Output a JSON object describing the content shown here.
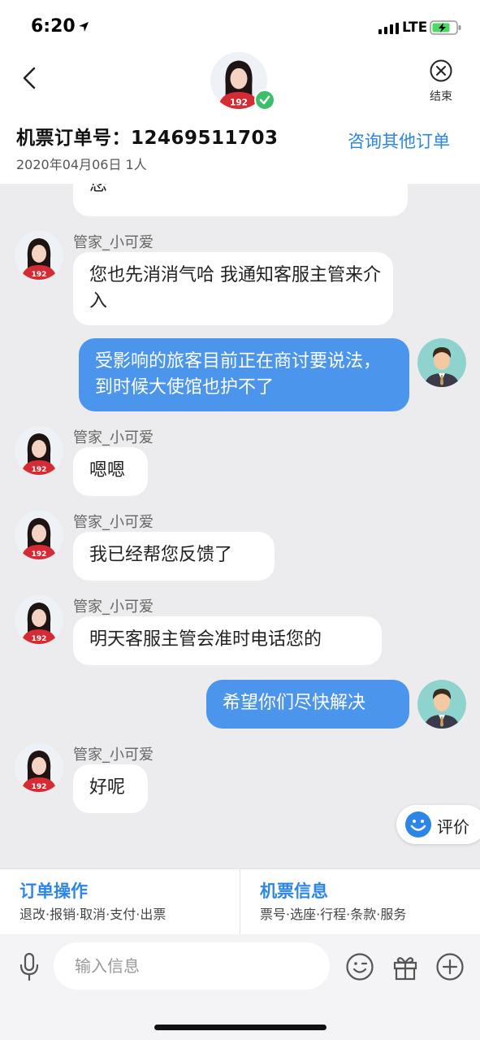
{
  "status_bar": {
    "time": "6:20",
    "network": "LTE"
  },
  "header": {
    "end_label": "结束",
    "order_title": "机票订单号：12469511703",
    "order_sub": "2020年04月06日 1人",
    "other_orders": "咨询其他订单"
  },
  "messages": [
    {
      "side": "left",
      "name": "",
      "text": "您"
    },
    {
      "side": "left",
      "name": "管家_小可爱",
      "text": "您也先消消气哈  我通知客服主管来介入"
    },
    {
      "side": "right",
      "text": "受影响的旅客目前正在商讨要说法，到时候大使馆也护不了"
    },
    {
      "side": "left",
      "name": "管家_小可爱",
      "text": "嗯嗯"
    },
    {
      "side": "left",
      "name": "管家_小可爱",
      "text": "我已经帮您反馈了"
    },
    {
      "side": "left",
      "name": "管家_小可爱",
      "text": "明天客服主管会准时电话您的"
    },
    {
      "side": "right",
      "text": "希望你们尽快解决"
    },
    {
      "side": "left",
      "name": "管家_小可爱",
      "text": "好呢"
    }
  ],
  "rate_label": "评价",
  "ops": [
    {
      "title": "订单操作",
      "sub": "退改·报销·取消·支付·出票"
    },
    {
      "title": "机票信息",
      "sub": "票号·选座·行程·条款·服务"
    }
  ],
  "input": {
    "placeholder": "输入信息"
  },
  "colors": {
    "accent": "#2b86e6",
    "bubble_right": "#4b95ec",
    "background": "#ececee"
  }
}
